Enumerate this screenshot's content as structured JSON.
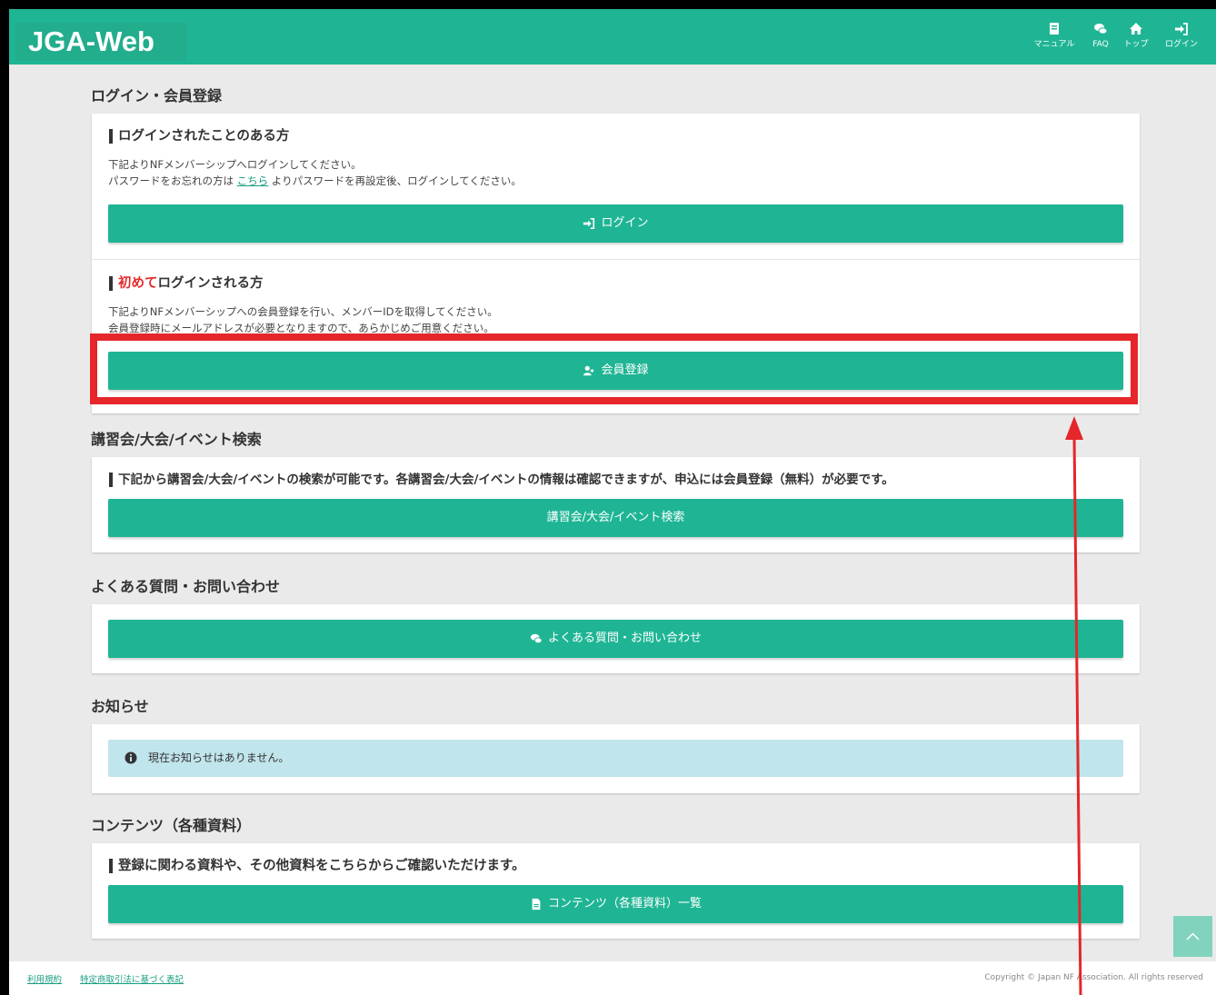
{
  "header": {
    "logo": "JGA-Web",
    "nav": [
      {
        "label": "マニュアル",
        "icon": "book-icon"
      },
      {
        "label": "FAQ",
        "icon": "comments-icon"
      },
      {
        "label": "トップ",
        "icon": "home-icon"
      },
      {
        "label": "ログイン",
        "icon": "sign-in-icon"
      }
    ]
  },
  "login_section": {
    "title": "ログイン・会員登録",
    "existing": {
      "heading": "ログインされたことのある方",
      "line1": "下記よりNFメンバーシップへログインしてください。",
      "line2_before": "パスワードをお忘れの方は ",
      "line2_link": "こちら",
      "line2_after": " よりパスワードを再設定後、ログインしてください。",
      "button": "ログイン"
    },
    "first_time": {
      "heading_red": "初めて",
      "heading_rest": "ログインされる方",
      "line1": "下記よりNFメンバーシップへの会員登録を行い、メンバーIDを取得してください。",
      "line2": "会員登録時にメールアドレスが必要となりますので、あらかじめご用意ください。",
      "button": "会員登録"
    }
  },
  "search_section": {
    "title": "講習会/大会/イベント検索",
    "heading": "下記から講習会/大会/イベントの検索が可能です。各講習会/大会/イベントの情報は確認できますが、申込には会員登録（無料）が必要です。",
    "button": "講習会/大会/イベント検索"
  },
  "faq_section": {
    "title": "よくある質問・お問い合わせ",
    "button": "よくある質問・お問い合わせ"
  },
  "news_section": {
    "title": "お知らせ",
    "message": "現在お知らせはありません。"
  },
  "contents_section": {
    "title": "コンテンツ（各種資料）",
    "heading": "登録に関わる資料や、その他資料をこちらからご確認いただけます。",
    "button": "コンテンツ（各種資料）一覧"
  },
  "footer": {
    "link1": "利用規約",
    "link2": "特定商取引法に基づく表記",
    "copyright": "Copyright © Japan NF Association. All rights reserved"
  },
  "colors": {
    "primary": "#1fb594",
    "highlight": "#e5262a",
    "info_bg": "#c0e5ec"
  }
}
